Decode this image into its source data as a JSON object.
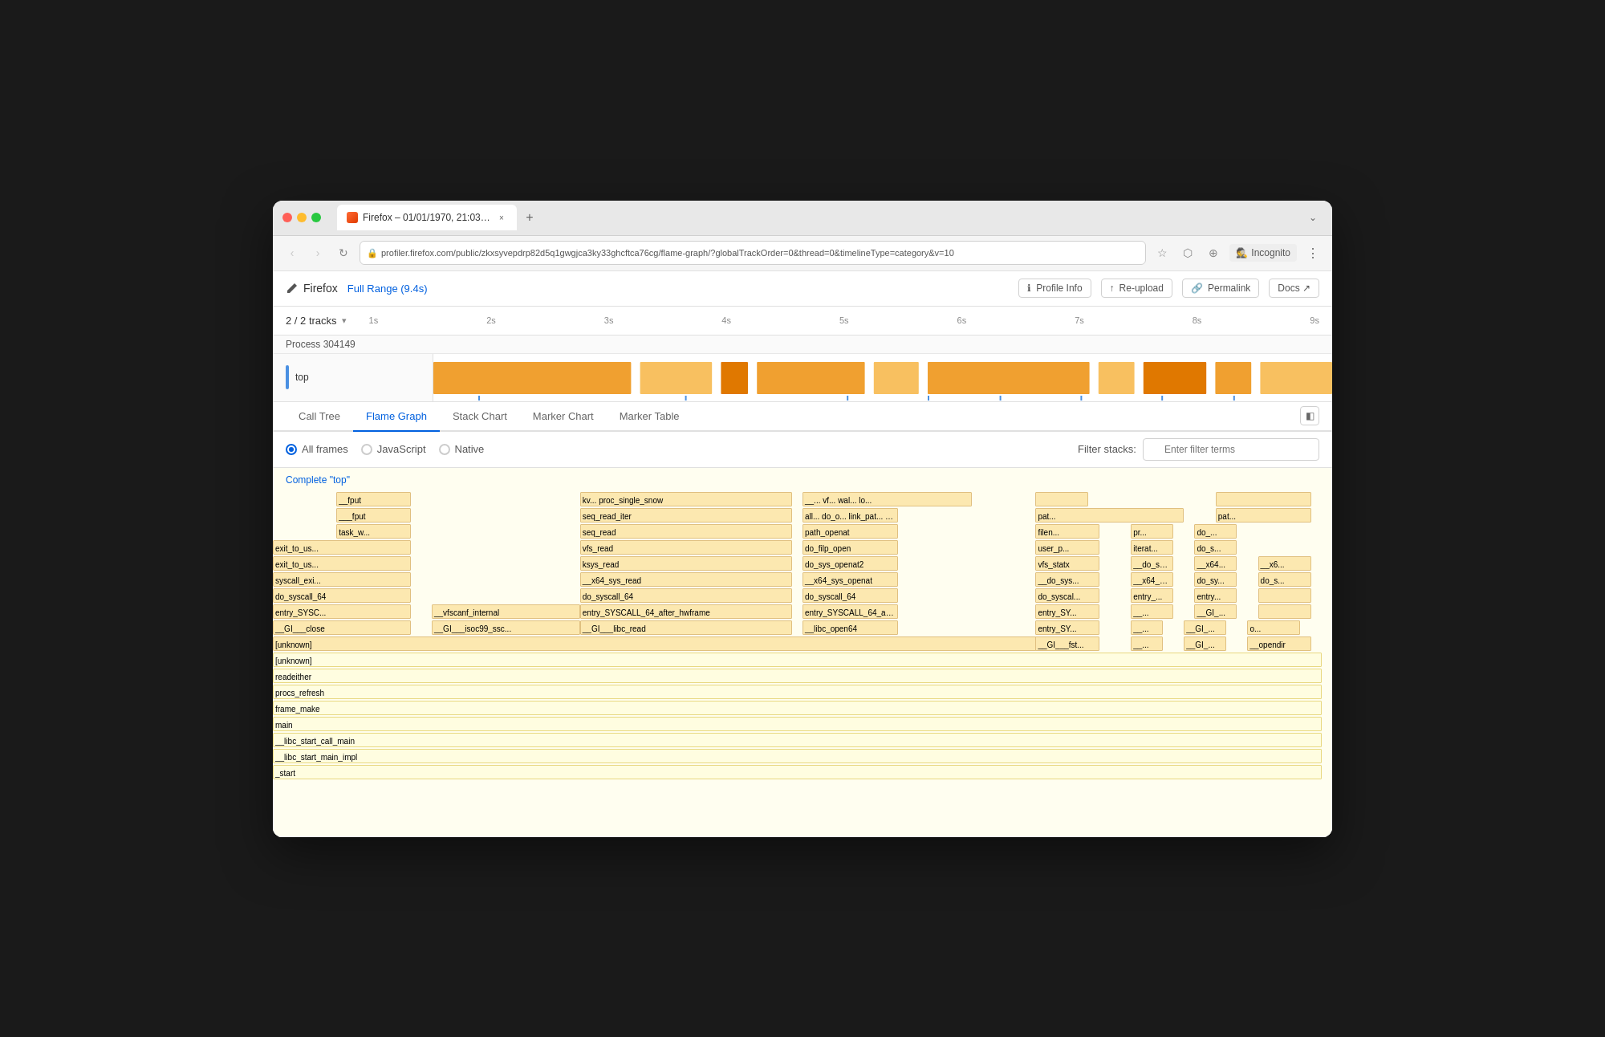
{
  "window": {
    "title": "Firefox – 01/01/1970, 21:03:1...",
    "url": "profiler.firefox.com/public/zkxsyvepdrp82d5q1gwgjca3ky33ghcftca76cg/flame-graph/?globalTrackOrder=0&thread=0&timelineType=category&v=10"
  },
  "browser": {
    "back_btn": "‹",
    "forward_btn": "›",
    "refresh_btn": "↻",
    "incognito_label": "Incognito",
    "new_tab_btn": "+",
    "more_btn": "⋮",
    "lock_icon": "🔒",
    "star_icon": "☆",
    "cast_icon": "⬡",
    "zoom_icon": "⊕"
  },
  "profiler": {
    "logo_label": "Firefox",
    "range_label": "Full Range (9.4s)",
    "profile_info_label": "Profile Info",
    "reupload_label": "Re-upload",
    "permalink_label": "Permalink",
    "docs_label": "Docs ↗"
  },
  "timeline": {
    "tracks_label": "2 / 2 tracks",
    "process_label": "Process 304149",
    "thread_label": "top",
    "time_marks": [
      "1s",
      "2s",
      "3s",
      "4s",
      "5s",
      "6s",
      "7s",
      "8s",
      "9s"
    ]
  },
  "tabs": {
    "items": [
      {
        "label": "Call Tree",
        "id": "call-tree",
        "active": false
      },
      {
        "label": "Flame Graph",
        "id": "flame-graph",
        "active": true
      },
      {
        "label": "Stack Chart",
        "id": "stack-chart",
        "active": false
      },
      {
        "label": "Marker Chart",
        "id": "marker-chart",
        "active": false
      },
      {
        "label": "Marker Table",
        "id": "marker-table",
        "active": false
      }
    ]
  },
  "filter_bar": {
    "all_frames_label": "All frames",
    "javascript_label": "JavaScript",
    "native_label": "Native",
    "filter_stacks_label": "Filter stacks:",
    "filter_placeholder": "Enter filter terms"
  },
  "flame_graph": {
    "section_title": "Complete \"top\"",
    "frames": [
      {
        "label": "__fput",
        "x": 6.5,
        "w": 8.5,
        "depth": 0,
        "color": "peach"
      },
      {
        "label": "___fput",
        "x": 6.5,
        "w": 8.5,
        "depth": 1,
        "color": "peach"
      },
      {
        "label": "task_w...",
        "x": 6.5,
        "w": 8.5,
        "depth": 2,
        "color": "peach"
      },
      {
        "label": "exit_to_us...",
        "x": 0,
        "w": 15,
        "depth": 3,
        "color": "peach"
      },
      {
        "label": "exit_to_us...",
        "x": 0,
        "w": 15,
        "depth": 4,
        "color": "peach"
      },
      {
        "label": "syscall_exi...",
        "x": 0,
        "w": 15,
        "depth": 5,
        "color": "peach"
      },
      {
        "label": "do_syscall_64",
        "x": 0,
        "w": 15,
        "depth": 6,
        "color": "peach"
      },
      {
        "label": "entry_SYSC...",
        "x": 0,
        "w": 15,
        "depth": 7,
        "color": "peach"
      },
      {
        "label": "__GI___close",
        "x": 0,
        "w": 15,
        "depth": 8,
        "color": "peach"
      },
      {
        "label": "[unknown]",
        "x": 0,
        "w": 100,
        "depth": 9,
        "color": "yellow-light"
      },
      {
        "label": "[unknown]",
        "x": 0,
        "w": 100,
        "depth": 10,
        "color": "yellow-light"
      },
      {
        "label": "readeither",
        "x": 0,
        "w": 100,
        "depth": 11,
        "color": "yellow-light"
      },
      {
        "label": "procs_refresh",
        "x": 0,
        "w": 100,
        "depth": 12,
        "color": "yellow-light"
      },
      {
        "label": "frame_make",
        "x": 0,
        "w": 100,
        "depth": 13,
        "color": "yellow-light"
      },
      {
        "label": "main",
        "x": 0,
        "w": 100,
        "depth": 14,
        "color": "yellow-light"
      },
      {
        "label": "__libc_start_call_main",
        "x": 0,
        "w": 100,
        "depth": 15,
        "color": "yellow-light"
      },
      {
        "label": "__libc_start_main_impl",
        "x": 0,
        "w": 100,
        "depth": 16,
        "color": "yellow-light"
      },
      {
        "label": "_start",
        "x": 0,
        "w": 100,
        "depth": 17,
        "color": "yellow-light"
      }
    ]
  }
}
